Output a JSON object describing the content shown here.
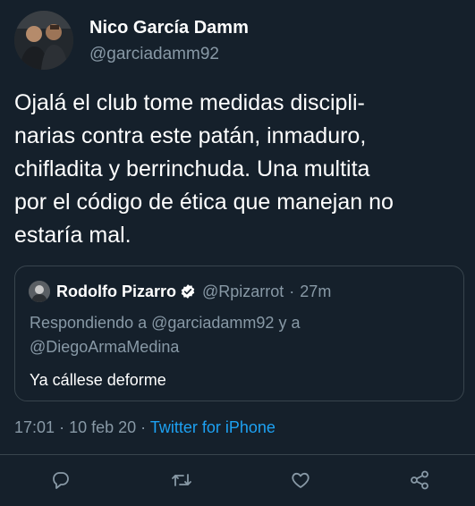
{
  "author": {
    "display_name": "Nico García Damm",
    "handle": "@garciadamm92"
  },
  "tweet": {
    "text_lines": [
      "Ojalá el club tome medidas discipli-",
      "narias contra este patán, inmaduro,",
      "chifladita y berrinchuda. Una multita",
      "por el código de ética que manejan no",
      "estaría mal."
    ],
    "time": "17:01",
    "date": "10 feb 20",
    "separator": "·",
    "source": "Twitter for iPhone"
  },
  "quoted": {
    "display_name": "Rodolfo Pizarro",
    "verified": true,
    "handle": "@Rpizarrot",
    "separator": "·",
    "time": "27m",
    "replying_to_line1": "Respondiendo a @garciadamm92 y a",
    "replying_to_line2": "@DiegoArmaMedina",
    "text": "Ya cállese deforme"
  },
  "actions": [
    {
      "name": "reply-icon"
    },
    {
      "name": "retweet-icon"
    },
    {
      "name": "like-icon"
    },
    {
      "name": "share-icon"
    }
  ],
  "colors": {
    "background": "#15202b",
    "primary_text": "#ffffff",
    "secondary_text": "#8899a6",
    "accent": "#1da1f2",
    "border": "#38444d"
  }
}
